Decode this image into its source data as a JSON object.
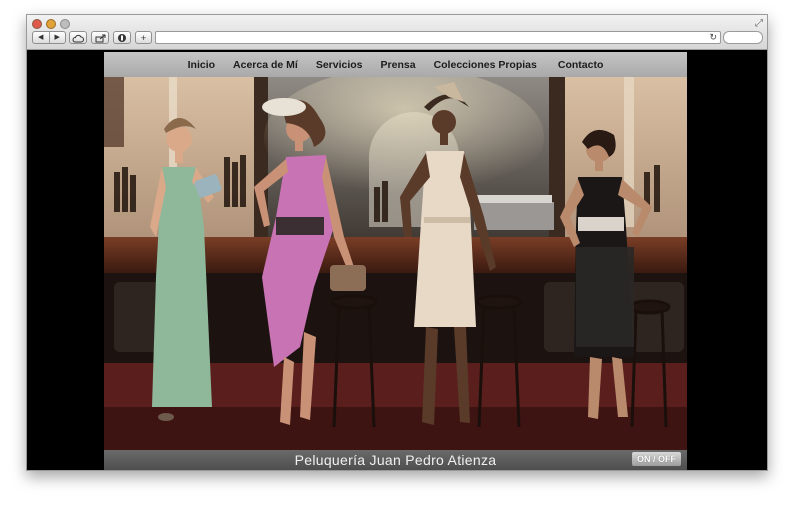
{
  "browser": {
    "nav_back": "◀",
    "nav_forward": "▶",
    "buttons": [
      "cloud-icon",
      "share-icon",
      "history-icon",
      "new-tab-icon"
    ],
    "new_tab_label": "+",
    "reload": "↻"
  },
  "menu": {
    "items": [
      "Inicio",
      "Acerca de Mí",
      "Servicios",
      "Prensa",
      "Colecciones Propias",
      "Contacto"
    ]
  },
  "hero": {
    "figures": [
      "green-gown-model",
      "pink-dress-model",
      "cream-dress-model",
      "black-dress-model"
    ]
  },
  "footer": {
    "title": "Peluquería Juan Pedro Atienza",
    "toggle": "ON / OFF"
  },
  "colors": {
    "menu_bar": "#b8b8b8",
    "window_bg": "#000000",
    "footer_bar": "#5a5a5a"
  }
}
